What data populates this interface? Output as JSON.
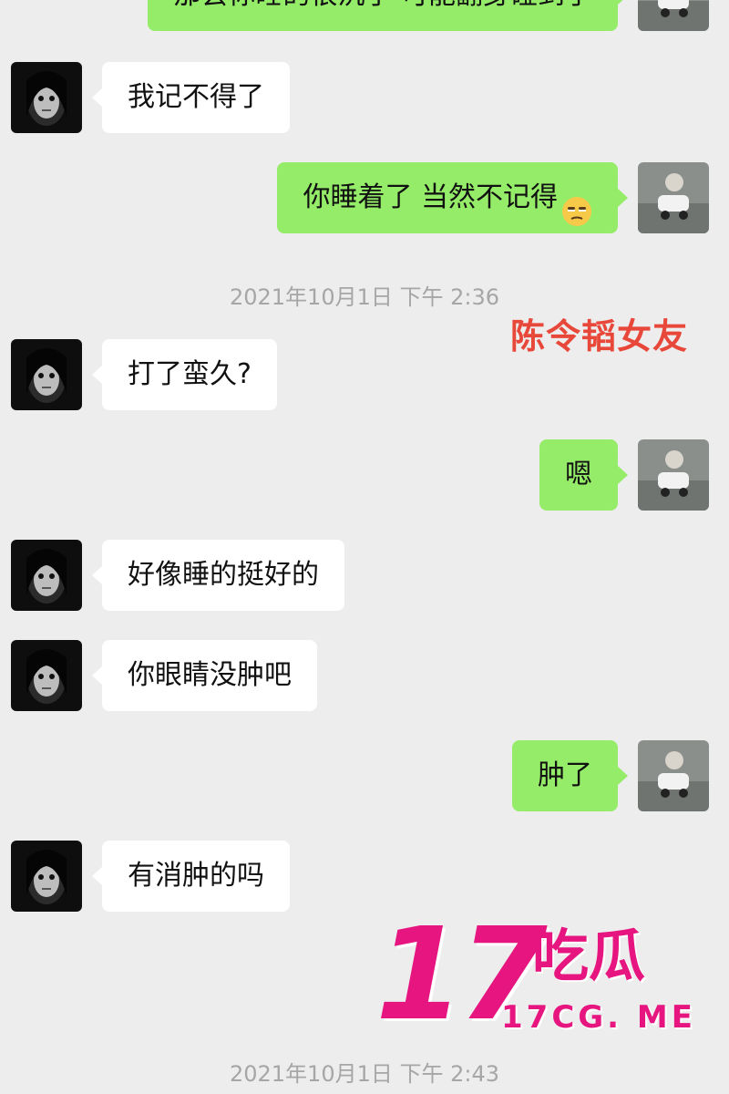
{
  "conversation": {
    "top_partial": {
      "text": "那会你睡的很沉了 可能翻身碰到了"
    },
    "messages": [
      {
        "side": "left",
        "text": "我记不得了"
      },
      {
        "side": "right",
        "text": "你睡着了 当然不记得",
        "emoji": "unamused-face-emoji"
      },
      {
        "side": "left",
        "text": "打了蛮久?"
      },
      {
        "side": "right",
        "text": "嗯"
      },
      {
        "side": "left",
        "text": "好像睡的挺好的"
      },
      {
        "side": "left",
        "text": "你眼睛没肿吧"
      },
      {
        "side": "right",
        "text": "肿了"
      },
      {
        "side": "left",
        "text": "有消肿的吗"
      }
    ],
    "timestamps": [
      "2021年10月1日 下午 2:36",
      "2021年10月1日 下午 2:43"
    ]
  },
  "overlay": {
    "caption": "陈令韬女友",
    "watermark": {
      "number": "17",
      "chinese": "吃瓜",
      "url": "17CG. ME"
    }
  },
  "colors": {
    "background": "#ededed",
    "incoming_bubble": "#ffffff",
    "outgoing_bubble": "#95ec69",
    "timestamp": "#a6a6a6",
    "caption": "#e8483a",
    "watermark": "#e6157f"
  }
}
